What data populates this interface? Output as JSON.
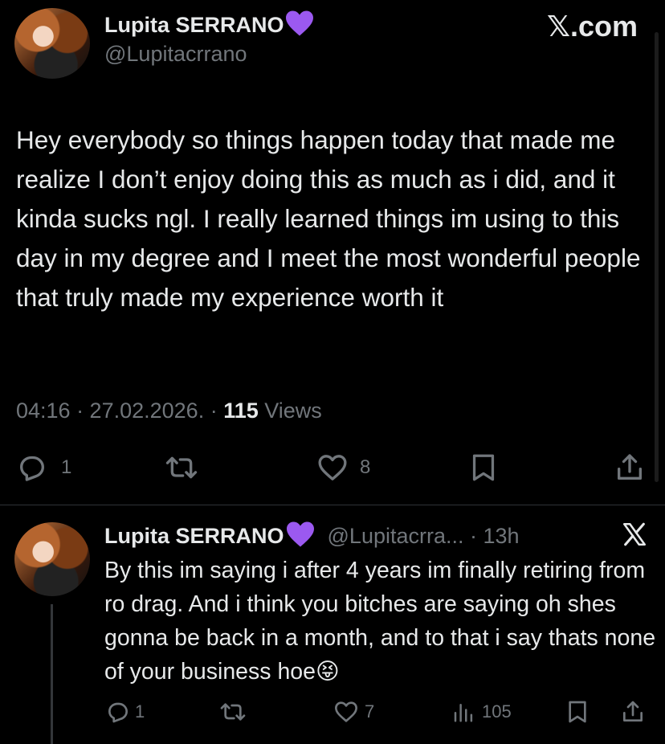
{
  "brand": {
    "site": "𝕏.com"
  },
  "main_post": {
    "author_name": "Lupita SERRANO",
    "handle": "@Lupitacrrano",
    "body": "Hey everybody so things happen today that made me realize I don’t enjoy doing this as much as i did, and it kinda sucks ngl.  I really learned things im using to this day in my degree and I meet the most wonderful people that truly made my experience worth it",
    "time": "04:16 · 27.02.2026. · ",
    "views_count": "115",
    "views_label": " Views",
    "actions": {
      "replies": "1",
      "likes": "8"
    }
  },
  "reply_post": {
    "author_name": "Lupita SERRANO",
    "handle_time": "@Lupitacrra... · 13h",
    "body": "By this im saying i after 4 years im finally retiring from ro drag. And i think you bitches are saying oh shes gonna be back in a month, and to that i say thats none of your business hoe😝",
    "actions": {
      "replies": "1",
      "likes": "7",
      "views": "105"
    }
  },
  "colors": {
    "background": "#000000",
    "text": "#e7e9ea",
    "muted": "#71767b",
    "badge": "#9b59f0"
  },
  "icons": [
    "purple-heart-icon",
    "x-logo-icon",
    "reply-icon",
    "retweet-icon",
    "like-icon",
    "bookmark-icon",
    "share-icon",
    "views-icon"
  ]
}
